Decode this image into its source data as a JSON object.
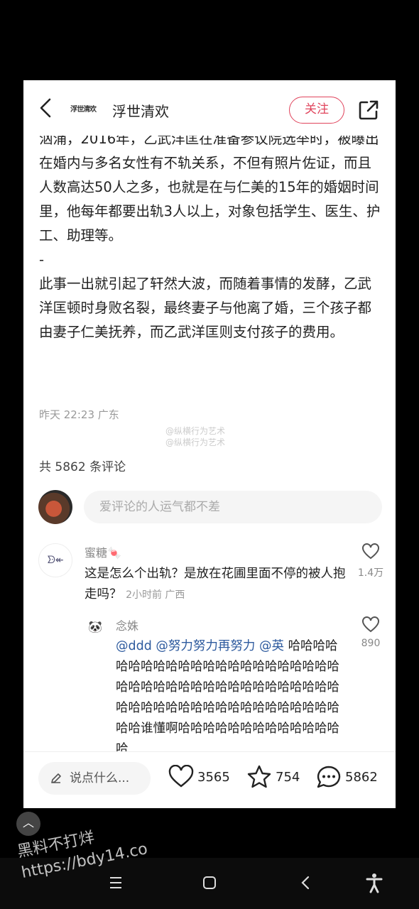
{
  "header": {
    "author_logo_text": "浮世清欢",
    "author_name": "浮世清欢",
    "follow_label": "关注"
  },
  "post": {
    "paragraph1": "汹涌，2016年，乙武洋匡在准备参议院选举时，被曝出在婚内与多名女性有不轨关系，不但有照片佐证，而且人数高达50人之多，也就是在与仁美的15年的婚姻时间里，他每年都要出轨3人以上，对象包括学生、医生、护工、助理等。",
    "separator": "-",
    "paragraph2": "此事一出就引起了轩然大波，而随着事情的发酵，乙武洋匡顿时身败名裂，最终妻子与他离了婚，三个孩子都由妻子仁美抚养，而乙武洋匡则支付孩子的费用。",
    "timestamp": "昨天 22:23 广东",
    "watermark_line1": "@纵横行为艺术",
    "watermark_line2": "@纵横行为艺术"
  },
  "comments_header": "共 5862 条评论",
  "comment_input_placeholder": "爱评论的人运气都不差",
  "comments": [
    {
      "name": "蜜糖🍬",
      "text": "这是怎么个出轨？是放在花圃里面不停的被人抱走吗？",
      "meta": "2小时前 广西",
      "likes": "1.4万"
    },
    {
      "name": "念姝",
      "mentions": [
        "@ddd",
        "@努力努力再努力",
        "@英"
      ],
      "text": "哈哈哈哈哈哈哈哈哈哈哈哈哈哈哈哈哈哈哈哈哈哈哈哈哈哈哈哈哈哈哈哈哈哈哈哈哈哈哈哈哈哈哈哈哈哈哈哈哈哈哈哈哈哈哈哈哈哈哈哈谁懂啊哈哈哈哈哈哈哈哈哈哈哈哈哈哈",
      "likes": "890"
    }
  ],
  "bottom_bar": {
    "say_placeholder": "说点什么...",
    "likes": "3565",
    "favorites": "754",
    "comments": "5862"
  },
  "overlay_watermark": {
    "line1": "黑料不打烊",
    "line2": "https://bdy14.co"
  },
  "icons": [
    "back-arrow-icon",
    "share-icon",
    "heart-icon",
    "star-icon",
    "chat-bubble-icon",
    "pencil-icon",
    "chevron-up-icon",
    "menu-icon",
    "home-square-icon",
    "back-triangle-icon",
    "accessibility-icon"
  ],
  "colors": {
    "accent": "#e0445c",
    "mention": "#2d5a9e"
  }
}
